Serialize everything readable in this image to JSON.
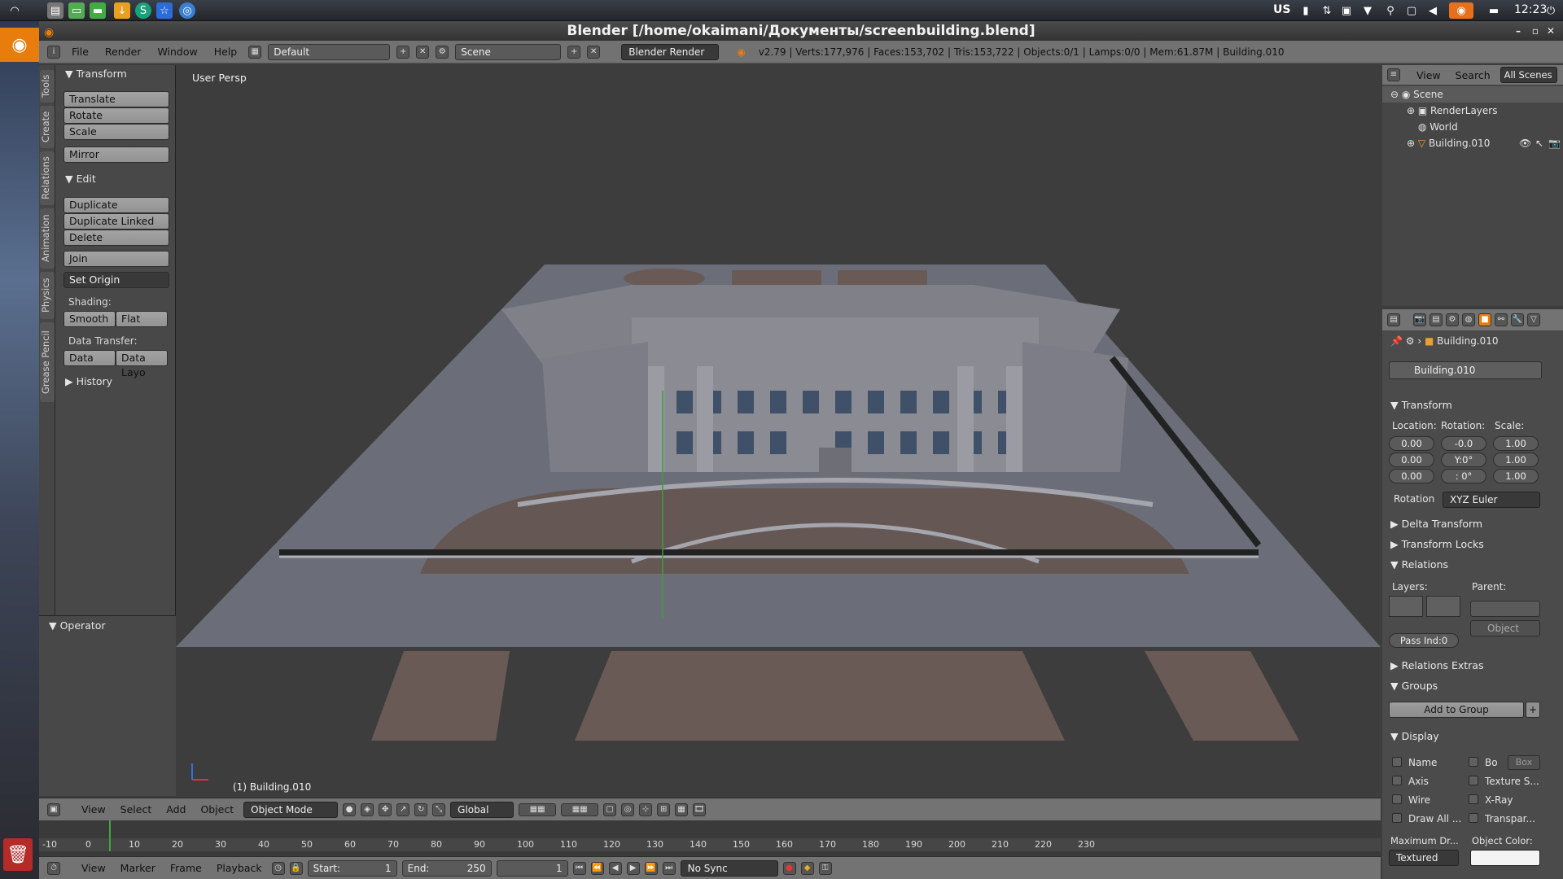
{
  "window": {
    "title": "Blender [/home/okaimani/Документы/screenbuilding.blend]"
  },
  "system_panel": {
    "layout": "US",
    "clock": "12:23"
  },
  "info_header": {
    "menus": [
      "File",
      "Render",
      "Window",
      "Help"
    ],
    "screen_layout": "Default",
    "scene": "Scene",
    "render_engine": "Blender Render",
    "stats": "v2.79 | Verts:177,976 | Faces:153,702 | Tris:153,722 | Objects:0/1 | Lamps:0/0 | Mem:61.87M | Building.010"
  },
  "tool_tabs": [
    "Tools",
    "Create",
    "Relations",
    "Animation",
    "Physics",
    "Grease Pencil"
  ],
  "toolshelf": {
    "transform_title": "Transform",
    "translate": "Translate",
    "rotate": "Rotate",
    "scale": "Scale",
    "mirror": "Mirror",
    "edit_title": "Edit",
    "duplicate": "Duplicate",
    "duplicate_linked": "Duplicate Linked",
    "delete": "Delete",
    "join": "Join",
    "set_origin": "Set Origin",
    "shading_label": "Shading:",
    "smooth": "Smooth",
    "flat": "Flat",
    "data_transfer_label": "Data Transfer:",
    "data": "Data",
    "data_layout": "Data Layo",
    "history": "History"
  },
  "operator_panel": {
    "title": "Operator"
  },
  "viewport": {
    "view_label": "User Persp",
    "object_label": "(1) Building.010"
  },
  "viewport_header": {
    "menus": [
      "View",
      "Select",
      "Add",
      "Object"
    ],
    "mode": "Object Mode",
    "orientation": "Global"
  },
  "timeline": {
    "ticks": [
      "-10",
      "0",
      "10",
      "20",
      "30",
      "40",
      "50",
      "60",
      "70",
      "80",
      "90",
      "100",
      "110",
      "120",
      "130",
      "140",
      "150",
      "160",
      "170",
      "180",
      "190",
      "200",
      "210",
      "220",
      "230"
    ],
    "menus": [
      "View",
      "Marker",
      "Frame",
      "Playback"
    ],
    "start_label": "Start:",
    "start": "1",
    "end_label": "End:",
    "end": "250",
    "current_frame": "1",
    "sync": "No Sync"
  },
  "outliner": {
    "menus": [
      "View",
      "Search"
    ],
    "filter": "All Scenes",
    "items": [
      "Scene",
      "RenderLayers",
      "World",
      "Building.010"
    ]
  },
  "properties": {
    "breadcrumb": "Building.010",
    "object_name": "Building.010",
    "transform_title": "Transform",
    "location_label": "Location:",
    "rotation_label": "Rotation:",
    "scale_label": "Scale:",
    "location": [
      "0.00",
      "0.00",
      "0.00"
    ],
    "rotation": [
      "-0.0",
      "Y:0°",
      ": 0°"
    ],
    "scale": [
      "1.00",
      "1.00",
      "1.00"
    ],
    "rotation_mode_label": "Rotation",
    "rotation_mode": "XYZ Euler",
    "delta_transform": "Delta Transform",
    "transform_locks": "Transform Locks",
    "relations_title": "Relations",
    "layers_label": "Layers:",
    "parent_label": "Parent:",
    "parent_type": "Object",
    "pass_index": "Pass Ind:0",
    "relations_extras": "Relations Extras",
    "groups_title": "Groups",
    "add_to_group": "Add to Group",
    "display_title": "Display",
    "display_left": [
      "Name",
      "Axis",
      "Wire",
      "Draw All ..."
    ],
    "display_right": [
      "Bo",
      "Texture S...",
      "X-Ray",
      "Transpar..."
    ],
    "bounds_type": "Box",
    "max_draw_label": "Maximum Dr...",
    "max_draw": "Textured",
    "object_color_label": "Object Color:"
  },
  "colors": {
    "accent": "#e87d0d",
    "header": "#737373",
    "panel": "#484848",
    "viewport": "#3d3d3d"
  }
}
